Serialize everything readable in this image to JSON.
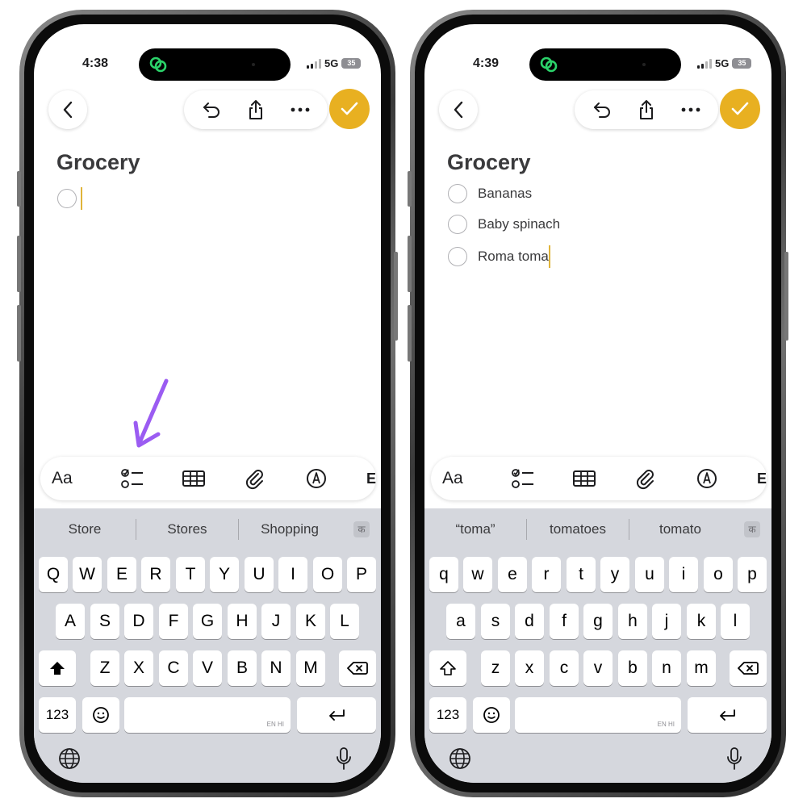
{
  "colors": {
    "accent": "#e8b021",
    "arrow": "#9b5cf2",
    "keyboard_bg": "#d5d7dd"
  },
  "phones": [
    {
      "status": {
        "time": "4:38",
        "network": "5G",
        "battery": "35"
      },
      "note": {
        "title": "Grocery",
        "items": [
          ""
        ]
      },
      "suggestions": [
        "Store",
        "Stores",
        "Shopping"
      ],
      "lang_badge": "क",
      "keyboard": {
        "row1": [
          "Q",
          "W",
          "E",
          "R",
          "T",
          "Y",
          "U",
          "I",
          "O",
          "P"
        ],
        "row2": [
          "A",
          "S",
          "D",
          "F",
          "G",
          "H",
          "J",
          "K",
          "L"
        ],
        "row3": [
          "Z",
          "X",
          "C",
          "V",
          "B",
          "N",
          "M"
        ],
        "numbers_label": "123",
        "space_hint": "EN HI",
        "shift_state": "active"
      },
      "format_bar": {
        "text_style_label": "Aa",
        "icons": [
          "checklist-icon",
          "table-icon",
          "paperclip-icon",
          "markup-icon"
        ],
        "cut_label": "E"
      },
      "annotation": {
        "arrow_target": "checklist-icon"
      }
    },
    {
      "status": {
        "time": "4:39",
        "network": "5G",
        "battery": "35"
      },
      "note": {
        "title": "Grocery",
        "items": [
          "Bananas",
          "Baby spinach",
          "Roma toma"
        ]
      },
      "suggestions": [
        "“toma”",
        "tomatoes",
        "tomato"
      ],
      "lang_badge": "क",
      "keyboard": {
        "row1": [
          "q",
          "w",
          "e",
          "r",
          "t",
          "y",
          "u",
          "i",
          "o",
          "p"
        ],
        "row2": [
          "a",
          "s",
          "d",
          "f",
          "g",
          "h",
          "j",
          "k",
          "l"
        ],
        "row3": [
          "z",
          "x",
          "c",
          "v",
          "b",
          "n",
          "m"
        ],
        "numbers_label": "123",
        "space_hint": "EN HI",
        "shift_state": "inactive"
      },
      "format_bar": {
        "text_style_label": "Aa",
        "icons": [
          "checklist-icon",
          "table-icon",
          "paperclip-icon",
          "markup-icon"
        ],
        "cut_label": "E"
      }
    }
  ]
}
